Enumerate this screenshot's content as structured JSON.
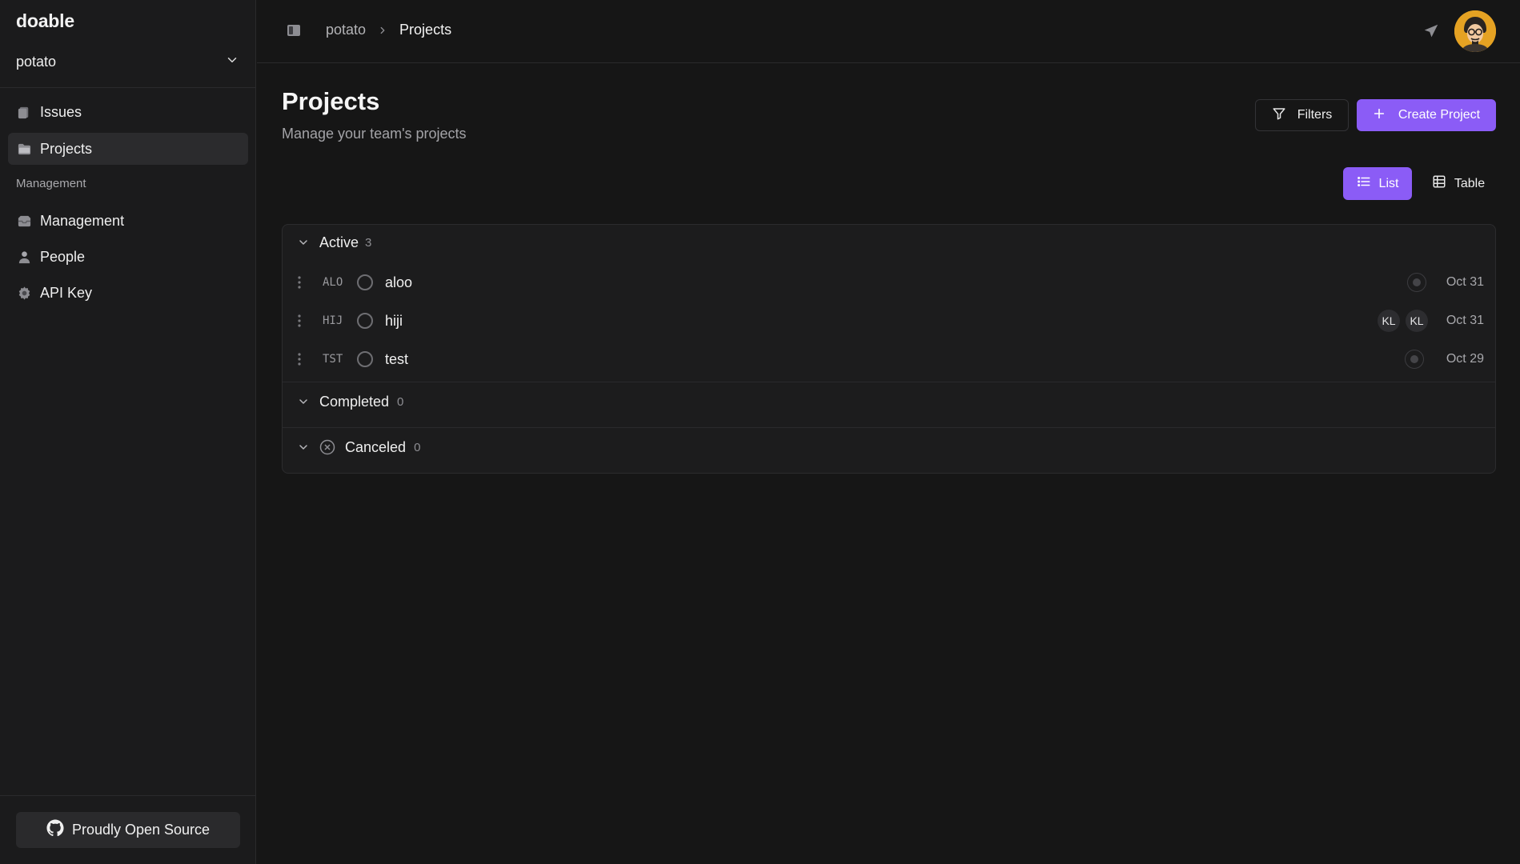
{
  "app": {
    "brand": "doable"
  },
  "sidebar": {
    "workspace": "potato",
    "nav": [
      {
        "label": "Issues",
        "icon": "issues-icon"
      },
      {
        "label": "Projects",
        "icon": "folder-icon",
        "active": true
      }
    ],
    "section_label": "Management",
    "management": [
      {
        "label": "Management",
        "icon": "inbox-icon"
      },
      {
        "label": "People",
        "icon": "person-icon"
      },
      {
        "label": "API Key",
        "icon": "gear-icon"
      }
    ],
    "footer_button": "Proudly Open Source"
  },
  "header": {
    "breadcrumb": [
      "potato",
      "Projects"
    ]
  },
  "page": {
    "title": "Projects",
    "subtitle": "Manage your team's projects",
    "filters_label": "Filters",
    "create_label": "Create Project",
    "view_list_label": "List",
    "view_table_label": "Table"
  },
  "groups": {
    "active": {
      "title": "Active",
      "count": "3",
      "projects": [
        {
          "key": "ALO",
          "name": "aloo",
          "lead": "",
          "date": "Oct 31"
        },
        {
          "key": "HIJ",
          "name": "hiji",
          "members": [
            "KL",
            "KL"
          ],
          "date": "Oct 31"
        },
        {
          "key": "TST",
          "name": "test",
          "lead": "",
          "date": "Oct 29"
        }
      ]
    },
    "completed": {
      "title": "Completed",
      "count": "0"
    },
    "canceled": {
      "title": "Canceled",
      "count": "0"
    }
  },
  "colors": {
    "accent": "#8b5cf6",
    "background": "#161616",
    "sidebar": "#1b1b1c",
    "avatar_bg": "#e5a223"
  }
}
